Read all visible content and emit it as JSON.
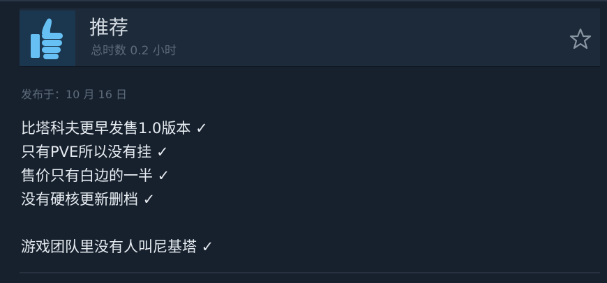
{
  "review": {
    "verdict": "推荐",
    "hours_on_record": "总时数 0.2 小时",
    "posted_date": "发布于：10 月 16 日",
    "lines": [
      "比塔科夫更早发售1.0版本 ✓",
      "只有PVE所以没有挂 ✓",
      "售价只有白边的一半 ✓",
      "没有硬核更新删档 ✓",
      "",
      "游戏团队里没有人叫尼基塔 ✓"
    ],
    "thumb_icon": "thumbs-up-icon",
    "award_icon": "star-outline-icon"
  },
  "colors": {
    "background": "#17212e",
    "header": "#1d2a39",
    "thumb_box": "#1b3750",
    "thumb": "#66c0f4",
    "verdict_text": "#d6dde4",
    "muted_text": "#5c6a79",
    "body_text": "#e6ebf0"
  }
}
